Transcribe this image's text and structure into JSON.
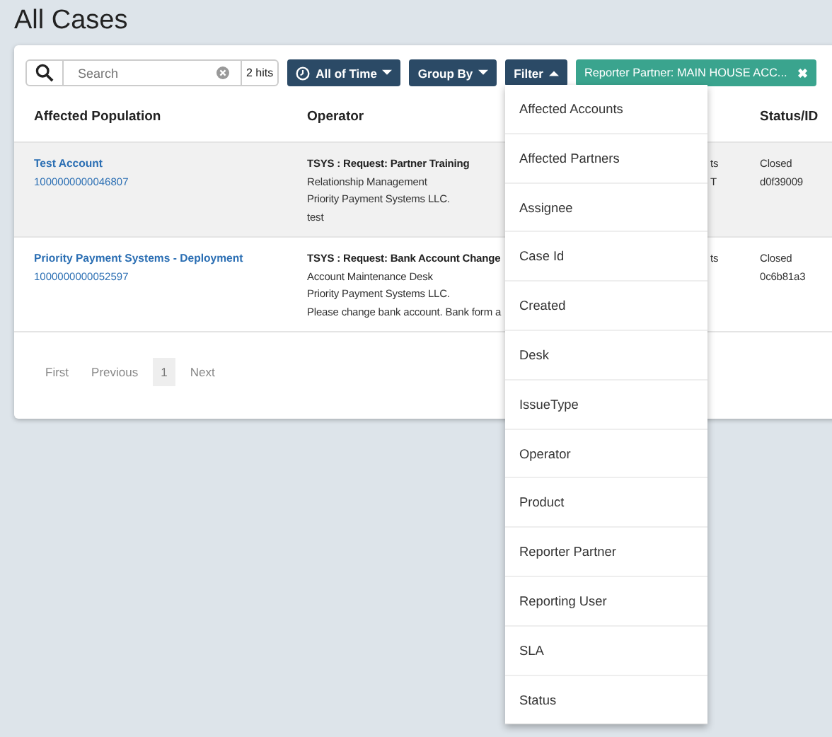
{
  "page_title": "All Cases",
  "search": {
    "placeholder": "Search",
    "hits": "2 hits"
  },
  "toolbar": [
    {
      "kind": "time",
      "label": "All of Time",
      "expanded": false
    },
    {
      "kind": "plain",
      "label": "Group By",
      "expanded": false
    },
    {
      "kind": "plain",
      "label": "Filter",
      "expanded": true
    }
  ],
  "active_filter": {
    "label": "Reporter Partner: MAIN HOUSE ACC...",
    "remove": "✖"
  },
  "table": {
    "columns": [
      "Affected Population",
      "Operator",
      "",
      "Status/ID"
    ],
    "rows": [
      {
        "selected": true,
        "account": "Test Account",
        "account_id": "1000000000046807",
        "operator_title": "TSYS : Request: Partner Training",
        "operator_lines": [
          "Relationship Management",
          "Priority Payment Systems LLC.",
          "test"
        ],
        "column_3": [
          "ts",
          "T"
        ],
        "status": "Closed",
        "id": "d0f39009"
      },
      {
        "selected": false,
        "account": "Priority Payment Systems - Deployment",
        "account_id": "1000000000052597",
        "operator_title": "TSYS : Request: Bank Account Change",
        "operator_lines": [
          "Account Maintenance Desk",
          "Priority Payment Systems LLC.",
          "Please change bank account. Bank form a"
        ],
        "column_3": [
          "ts"
        ],
        "status": "Closed",
        "id": "0c6b81a3"
      }
    ]
  },
  "pagination": [
    {
      "label": "First",
      "selected": false
    },
    {
      "label": "Previous",
      "selected": false
    },
    {
      "label": "1",
      "selected": true
    },
    {
      "label": "Next",
      "selected": false
    }
  ],
  "filter_menu": [
    "Affected Accounts",
    "Affected Partners",
    "Assignee",
    "Case Id",
    "Created",
    "Desk",
    "IssueType",
    "Operator",
    "Product",
    "Reporter Partner",
    "Reporting User",
    "SLA",
    "Status"
  ]
}
